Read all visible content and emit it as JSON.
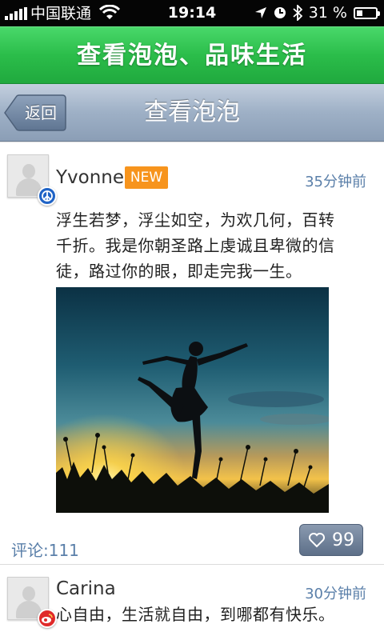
{
  "status_bar": {
    "carrier": "中国联通",
    "time": "19:14",
    "battery": "31 %",
    "battery_level": 0.31,
    "icons": [
      "signal-icon",
      "wifi-icon",
      "location-arrow-icon",
      "alarm-clock-icon",
      "bluetooth-icon",
      "battery-icon"
    ]
  },
  "banner": {
    "text": "查看泡泡、品味生活"
  },
  "nav": {
    "back_label": "返回",
    "title": "查看泡泡"
  },
  "posts": [
    {
      "username": "Yvonne",
      "tag": "NEW",
      "time": "35分钟前",
      "text_lines": [
        "浮生若梦，浮尘如空，为欢几何，百转",
        "千折。我是你朝圣路上虔诚且卑微的信",
        "徒，路过你的眼，即走完我一生。"
      ],
      "source_icon": "peace-sign-icon",
      "comments": "评论:111",
      "likes": "99"
    },
    {
      "username": "Carina",
      "time": "30分钟前",
      "text_lines": [
        "心自由，生活就自由，到哪都有快乐。"
      ],
      "source_icon": "weibo-icon"
    }
  ],
  "colors": {
    "banner_green": "#2bbd4a",
    "nav_blue_gray": "#9eb0c6",
    "new_tag_orange": "#f7941d",
    "link_blue": "#5a7fa9"
  }
}
